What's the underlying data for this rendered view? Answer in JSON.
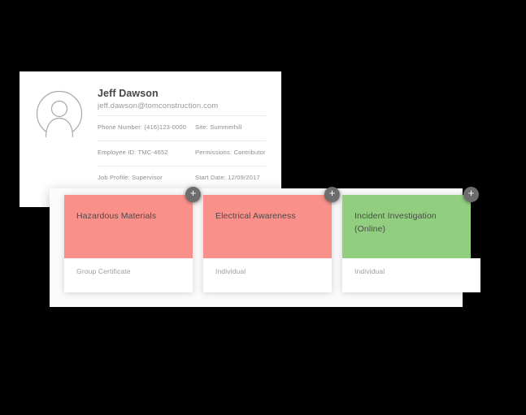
{
  "profile": {
    "name": "Jeff Dawson",
    "email": "jeff.dawson@tomconstruction.com",
    "avatar_icon": "user-avatar-icon",
    "details": [
      {
        "left": "Phone Number: (416)123-0000",
        "right": "Site: Summerhill"
      },
      {
        "left": "Employee ID: TMC-4652",
        "right": "Permissions: Contributor"
      },
      {
        "left": "Job Profile: Supervisor",
        "right": "Start Date: 12/09/2017"
      }
    ]
  },
  "courses": {
    "add_icon": "plus-icon",
    "cards": [
      {
        "title": "Hazardous Materials",
        "type": "Group Certificate",
        "color": "#F9908A",
        "status": "overdue"
      },
      {
        "title": "Electrical Awareness",
        "type": "Individual",
        "color": "#F9908A",
        "status": "overdue"
      },
      {
        "title": "Incident Investigation (Online)",
        "type": "Individual",
        "color": "#92CE7F",
        "status": "valid"
      }
    ]
  },
  "colors": {
    "card_red": "#F9908A",
    "card_green": "#92CE7F",
    "badge_grey": "#6D6D6D",
    "panel_bg": "#FBFBFB",
    "background": "#000000"
  }
}
